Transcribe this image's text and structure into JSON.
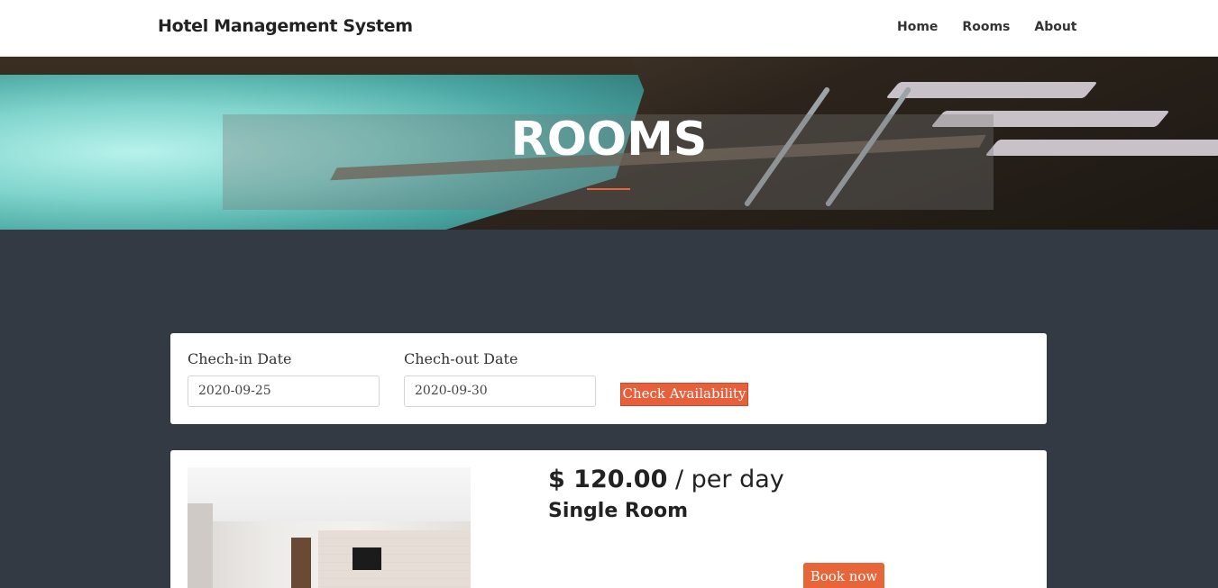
{
  "navbar": {
    "brand": "Hotel Management System",
    "links": [
      {
        "label": "Home"
      },
      {
        "label": "Rooms"
      },
      {
        "label": "About"
      }
    ]
  },
  "hero": {
    "title": "ROOMS"
  },
  "search": {
    "checkin_label": "Chech-in Date",
    "checkin_value": "2020-09-25",
    "checkout_label": "Chech-out Date",
    "checkout_value": "2020-09-30",
    "button_label": "Check Availability"
  },
  "rooms": [
    {
      "price": "$ 120.00",
      "price_suffix": "/ per day",
      "name": "Single Room",
      "book_label": "Book now"
    }
  ],
  "colors": {
    "accent": "#e8653a",
    "page_background": "#343a44",
    "card_background": "#ffffff"
  }
}
